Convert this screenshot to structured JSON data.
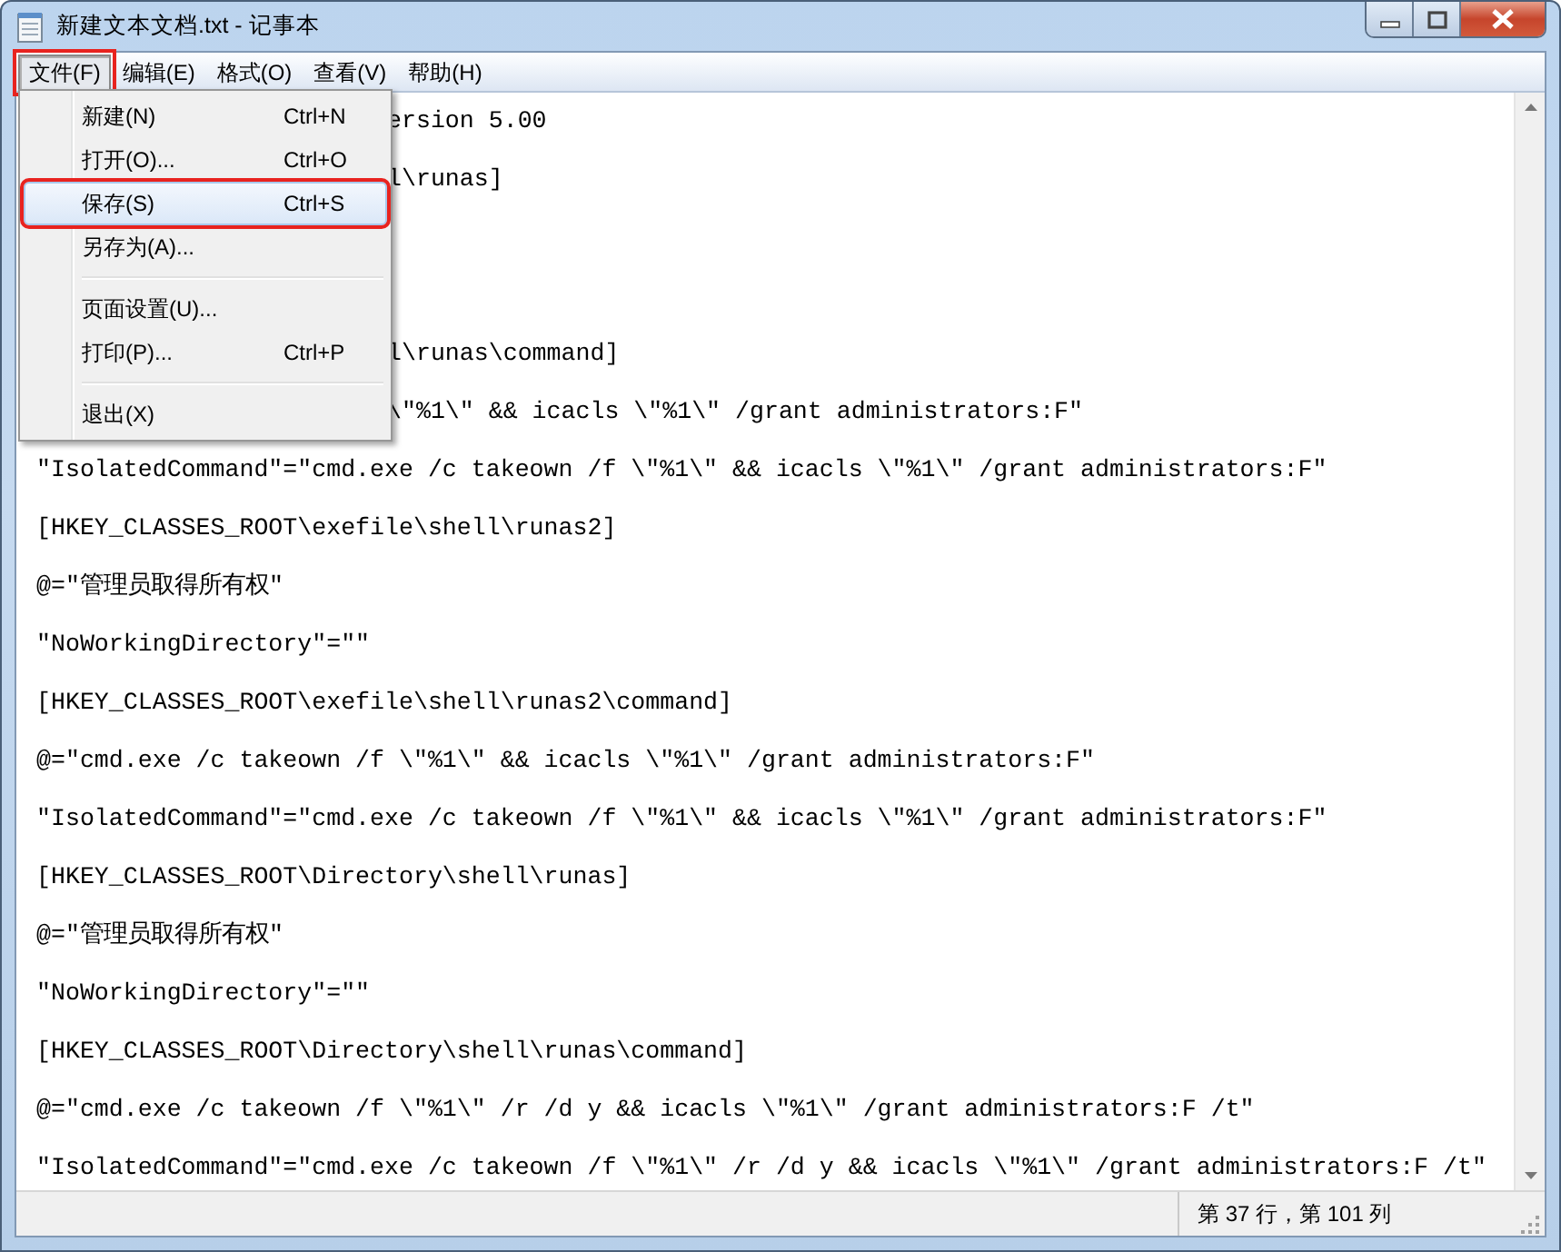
{
  "window": {
    "title": "新建文本文档.txt - 记事本"
  },
  "menu_bar": [
    {
      "label": "文件(F)",
      "selected": true,
      "marked": true
    },
    {
      "label": "编辑(E)",
      "selected": false,
      "marked": false
    },
    {
      "label": "格式(O)",
      "selected": false,
      "marked": false
    },
    {
      "label": "查看(V)",
      "selected": false,
      "marked": false
    },
    {
      "label": "帮助(H)",
      "selected": false,
      "marked": false
    }
  ],
  "file_menu": [
    {
      "kind": "item",
      "label": "新建(N)",
      "shortcut": "Ctrl+N",
      "selected": false,
      "marked": false
    },
    {
      "kind": "item",
      "label": "打开(O)...",
      "shortcut": "Ctrl+O",
      "selected": false,
      "marked": false
    },
    {
      "kind": "item",
      "label": "保存(S)",
      "shortcut": "Ctrl+S",
      "selected": true,
      "marked": true
    },
    {
      "kind": "item",
      "label": "另存为(A)...",
      "selected": false,
      "marked": false
    },
    {
      "kind": "separator"
    },
    {
      "kind": "item",
      "label": "页面设置(U)...",
      "selected": false,
      "marked": false
    },
    {
      "kind": "item",
      "label": "打印(P)...",
      "shortcut": "Ctrl+P",
      "selected": false,
      "marked": false
    },
    {
      "kind": "separator"
    },
    {
      "kind": "item",
      "label": "退出(X)",
      "selected": false,
      "marked": false
    }
  ],
  "editor_lines": [
    {
      "kind": "partial",
      "text": "ersion 5.00"
    },
    {
      "kind": "partial",
      "text": "l\\runas]"
    },
    {
      "kind": "covered"
    },
    {
      "kind": "covered"
    },
    {
      "kind": "partial",
      "text": "l\\runas\\command]"
    },
    {
      "kind": "partial",
      "text": "\\\"%1\\\" && icacls \\\"%1\\\" /grant administrators:F\""
    },
    {
      "kind": "full",
      "text": "\"IsolatedCommand\"=\"cmd.exe /c takeown /f \\\"%1\\\" && icacls \\\"%1\\\" /grant administrators:F\""
    },
    {
      "kind": "full",
      "text": "[HKEY_CLASSES_ROOT\\exefile\\shell\\runas2]"
    },
    {
      "kind": "full",
      "text": "@=\"管理员取得所有权\""
    },
    {
      "kind": "full",
      "text": "\"NoWorkingDirectory\"=\"\""
    },
    {
      "kind": "full",
      "text": "[HKEY_CLASSES_ROOT\\exefile\\shell\\runas2\\command]"
    },
    {
      "kind": "full",
      "text": "@=\"cmd.exe /c takeown /f \\\"%1\\\" && icacls \\\"%1\\\" /grant administrators:F\""
    },
    {
      "kind": "full",
      "text": "\"IsolatedCommand\"=\"cmd.exe /c takeown /f \\\"%1\\\" && icacls \\\"%1\\\" /grant administrators:F\""
    },
    {
      "kind": "full",
      "text": "[HKEY_CLASSES_ROOT\\Directory\\shell\\runas]"
    },
    {
      "kind": "full",
      "text": "@=\"管理员取得所有权\""
    },
    {
      "kind": "full",
      "text": "\"NoWorkingDirectory\"=\"\""
    },
    {
      "kind": "full",
      "text": "[HKEY_CLASSES_ROOT\\Directory\\shell\\runas\\command]"
    },
    {
      "kind": "full",
      "text": "@=\"cmd.exe /c takeown /f \\\"%1\\\" /r /d y && icacls \\\"%1\\\" /grant administrators:F /t\""
    },
    {
      "kind": "full",
      "text": "\"IsolatedCommand\"=\"cmd.exe /c takeown /f \\\"%1\\\" /r /d y && icacls \\\"%1\\\" /grant administrators:F /t\""
    }
  ],
  "status_bar": {
    "position": "第 37 行，第 101 列"
  }
}
